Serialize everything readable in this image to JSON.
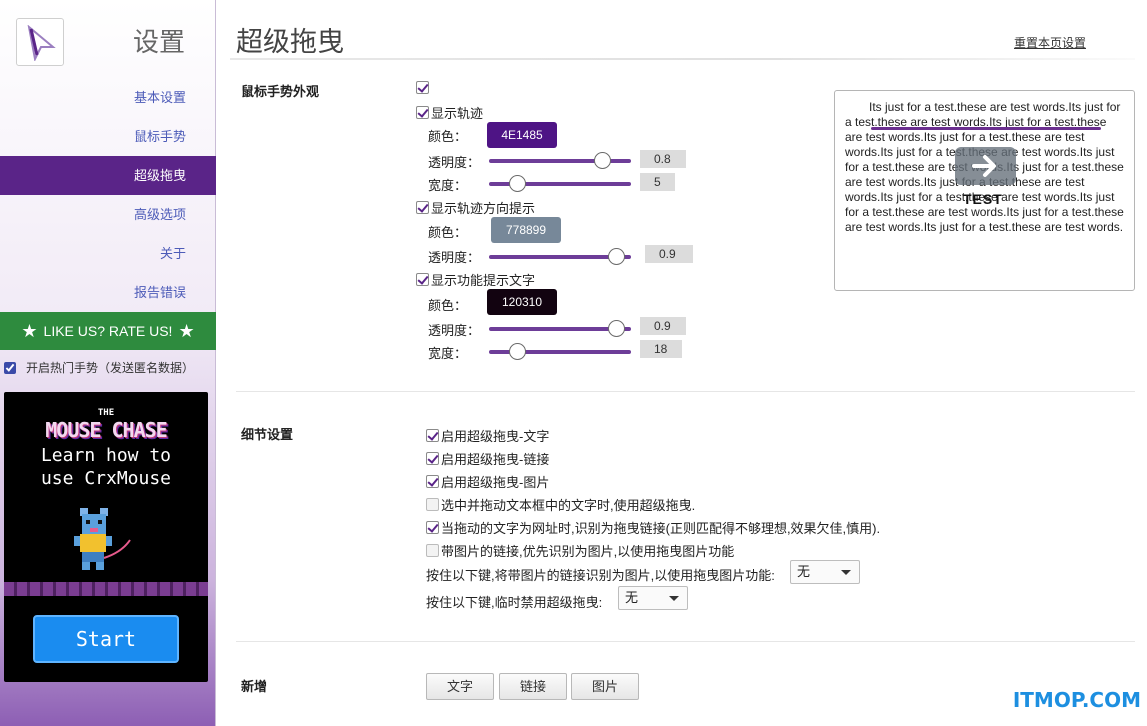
{
  "sidebar": {
    "title": "设置",
    "items": [
      {
        "label": "基本设置"
      },
      {
        "label": "鼠标手势"
      },
      {
        "label": "超级拖曳"
      },
      {
        "label": "高级选项"
      },
      {
        "label": "关于"
      },
      {
        "label": "报告错误"
      }
    ],
    "active_index": 2,
    "rate_label": "LIKE US? RATE US!",
    "hot_gestures_label": "开启热门手势（发送匿名数据）",
    "hot_gestures_checked": true,
    "promo": {
      "the": "THE",
      "title": "MOUSE CHASE",
      "line1": "Learn how to",
      "line2": "use CrxMouse",
      "button": "Start"
    }
  },
  "header": {
    "title": "超级拖曳",
    "reset_link": "重置本页设置"
  },
  "appearance": {
    "section_label": "鼠标手势外观",
    "enable_checked": true,
    "trail": {
      "label": "显示轨迹",
      "checked": true,
      "color_label": "颜色：",
      "color_value": "4E1485",
      "color_hex": "#4E1485",
      "opacity_label": "透明度：",
      "opacity_value": "0.8",
      "opacity_fraction": 0.8,
      "width_label": "宽度：",
      "width_value": "5",
      "width_fraction": 0.2
    },
    "direction": {
      "label": "显示轨迹方向提示",
      "checked": true,
      "color_label": "颜色：",
      "color_value": "778899",
      "color_hex": "#778899",
      "opacity_label": "透明度：",
      "opacity_value": "0.9",
      "opacity_fraction": 0.9
    },
    "tip_text": {
      "label": "显示功能提示文字",
      "checked": true,
      "color_label": "颜色：",
      "color_value": "120310",
      "color_hex": "#120310",
      "opacity_label": "透明度：",
      "opacity_value": "0.9",
      "opacity_fraction": 0.9,
      "width_label": "宽度：",
      "width_value": "18",
      "width_fraction": 0.2
    },
    "preview": {
      "text": "Its just for a test.these are test words.Its just for a test.these are test words.Its just for a test.these are test words.Its just for a test.these are test words.Its just for a test.these are test words.Its just for a test.these are test words.Its just for a test.these are test words.Its just for a test.these are test words.Its just for a test.these are test words.Its just for a test.these are test words.Its just for a test.these are test words.Its just for a test.these are test words.",
      "tip_label": "TEST"
    }
  },
  "details": {
    "section_label": "细节设置",
    "options": [
      {
        "label": "启用超级拖曳-文字",
        "checked": true
      },
      {
        "label": "启用超级拖曳-链接",
        "checked": true
      },
      {
        "label": "启用超级拖曳-图片",
        "checked": true
      },
      {
        "label": "选中并拖动文本框中的文字时,使用超级拖曳.",
        "checked": false
      },
      {
        "label": "当拖动的文字为网址时,识别为拖曳链接(正则匹配得不够理想,效果欠佳,慎用).",
        "checked": true
      },
      {
        "label": "带图片的链接,优先识别为图片,以使用拖曳图片功能",
        "checked": false
      }
    ],
    "key_image_label": "按住以下键,将带图片的链接识别为图片,以使用拖曳图片功能:",
    "key_image_value": "无",
    "key_disable_label": "按住以下键,临时禁用超级拖曳:",
    "key_disable_value": "无"
  },
  "add_new": {
    "section_label": "新增",
    "buttons": [
      "文字",
      "链接",
      "图片"
    ]
  },
  "watermark": "ITMOP.COM"
}
